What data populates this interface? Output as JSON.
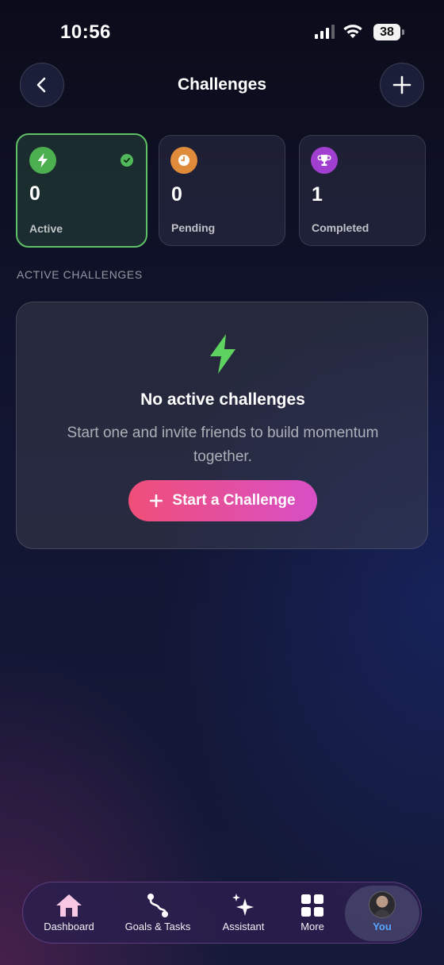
{
  "status_bar": {
    "time": "10:56",
    "battery": "38"
  },
  "header": {
    "title": "Challenges"
  },
  "stats": [
    {
      "count": "0",
      "label": "Active",
      "color": "#4caf50",
      "selected": true
    },
    {
      "count": "0",
      "label": "Pending",
      "color": "#e08a3c",
      "selected": false
    },
    {
      "count": "1",
      "label": "Completed",
      "color": "#a13fd0",
      "selected": false
    }
  ],
  "section": {
    "heading": "ACTIVE CHALLENGES"
  },
  "empty_state": {
    "title": "No active challenges",
    "description": "Start one and invite friends to build momentum together.",
    "cta_label": "Start a Challenge",
    "accent": "#5fd35f"
  },
  "tabbar": {
    "items": [
      {
        "label": "Dashboard",
        "icon": "home-icon"
      },
      {
        "label": "Goals & Tasks",
        "icon": "route-icon"
      },
      {
        "label": "Assistant",
        "icon": "sparkles-icon"
      },
      {
        "label": "More",
        "icon": "grid-icon"
      },
      {
        "label": "You",
        "icon": "avatar",
        "active": true
      }
    ]
  }
}
